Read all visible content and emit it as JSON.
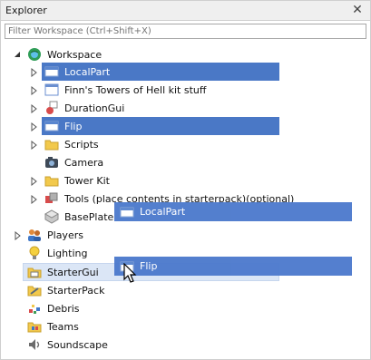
{
  "window": {
    "title": "Explorer",
    "close_glyph": "✕"
  },
  "filter": {
    "placeholder": "Filter Workspace (Ctrl+Shift+X)"
  },
  "tree": {
    "workspace": "Workspace",
    "localpart": "LocalPart",
    "finns": "Finn's Towers of Hell kit stuff",
    "durationgui": "DurationGui",
    "flip": "Flip",
    "scripts": "Scripts",
    "camera": "Camera",
    "towerkit": "Tower Kit",
    "tools": "Tools (place contents in starterpack)(optional)",
    "baseplate": "BasePlate",
    "players": "Players",
    "lighting": "Lighting",
    "startergui": "StarterGui",
    "starterpack": "StarterPack",
    "debris": "Debris",
    "teams": "Teams",
    "soundscape": "Soundscape"
  },
  "drag": {
    "ghost1": "LocalPart",
    "ghost2": "Flip"
  },
  "colors": {
    "selection": "#4a78c6",
    "drag_ghost": "#4d7acd",
    "hover": "#dbe6f6"
  }
}
